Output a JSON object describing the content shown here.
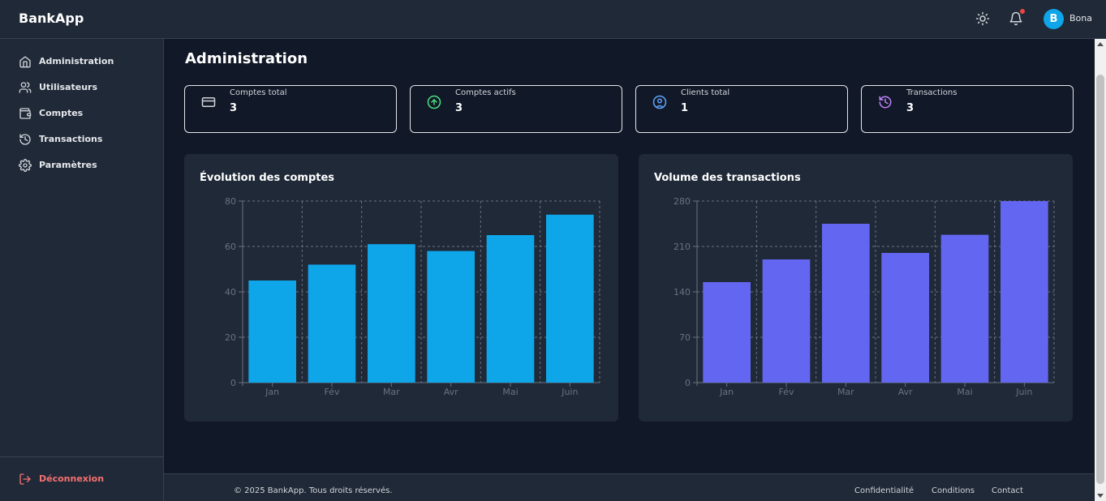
{
  "app": {
    "brand": "BankApp"
  },
  "header": {
    "icons": [
      "sun-icon",
      "bell-icon"
    ],
    "user": {
      "initial": "B",
      "name": "Bona",
      "avatar_color": "#0ea5e9"
    }
  },
  "sidebar": {
    "items": [
      {
        "label": "Administration",
        "icon": "home-icon"
      },
      {
        "label": "Utilisateurs",
        "icon": "users-icon"
      },
      {
        "label": "Comptes",
        "icon": "wallet-icon"
      },
      {
        "label": "Transactions",
        "icon": "history-icon"
      },
      {
        "label": "Paramètres",
        "icon": "gear-icon"
      }
    ],
    "logout": {
      "label": "Déconnexion",
      "icon": "logout-icon",
      "color": "#f87171"
    }
  },
  "main": {
    "title": "Administration",
    "stats": [
      {
        "label": "Comptes total",
        "value": "3",
        "icon": "credit-card-icon",
        "color": "#d1d5db"
      },
      {
        "label": "Comptes actifs",
        "value": "3",
        "icon": "arrow-up-circle-icon",
        "color": "#4ade80"
      },
      {
        "label": "Clients total",
        "value": "1",
        "icon": "user-circle-icon",
        "color": "#60a5fa"
      },
      {
        "label": "Transactions",
        "value": "3",
        "icon": "history-icon",
        "color": "#c084fc"
      }
    ]
  },
  "chart_data": [
    {
      "type": "bar",
      "title": "Évolution des comptes",
      "categories": [
        "Jan",
        "Fév",
        "Mar",
        "Avr",
        "Mai",
        "Juin"
      ],
      "values": [
        45,
        52,
        61,
        58,
        65,
        74
      ],
      "ylim": [
        0,
        80
      ],
      "yticks": [
        "0",
        "20",
        "40",
        "60",
        "80"
      ],
      "color": "#0ea5e9",
      "grid": true
    },
    {
      "type": "bar",
      "title": "Volume des transactions",
      "categories": [
        "Jan",
        "Fév",
        "Mar",
        "Avr",
        "Mai",
        "Juin"
      ],
      "values": [
        155,
        190,
        245,
        200,
        228,
        280
      ],
      "ylim": [
        0,
        280
      ],
      "yticks": [
        "0",
        "70",
        "140",
        "210",
        "280"
      ],
      "color": "#6366f1",
      "grid": true
    }
  ],
  "footer": {
    "copyright": "© 2025 BankApp. Tous droits réservés.",
    "links": [
      "Confidentialité",
      "Conditions",
      "Contact"
    ]
  }
}
